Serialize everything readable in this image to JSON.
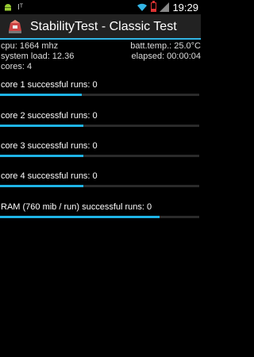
{
  "status_bar": {
    "usb_label": "Iᵀ",
    "time": "19:29",
    "colors": {
      "battery": "#dd3333"
    }
  },
  "app_bar": {
    "title": "StabilityTest - Classic Test",
    "icon": "stability-test-app-icon"
  },
  "system_info": {
    "cpu": "cpu: 1664 mhz",
    "batt_temp": "batt.temp.: 25.0°C",
    "system_load": "system load: 12.36",
    "elapsed": "elapsed: 00:00:04",
    "cores": "cores: 4"
  },
  "tests": [
    {
      "label": "core 1 successful runs: 0",
      "progress": 0.41
    },
    {
      "label": "core 2 successful runs: 0",
      "progress": 0.42
    },
    {
      "label": "core 3 successful runs: 0",
      "progress": 0.42
    },
    {
      "label": "core 4 successful runs: 0",
      "progress": 0.42
    },
    {
      "label": "RAM (760 mib / run) successful runs: 0",
      "progress": 0.8
    }
  ],
  "colors": {
    "accent": "#33b5e5",
    "progress_fill": "#1eb4e6",
    "progress_track": "#2a2a2a",
    "background": "#000000",
    "action_bar": "#222222"
  }
}
